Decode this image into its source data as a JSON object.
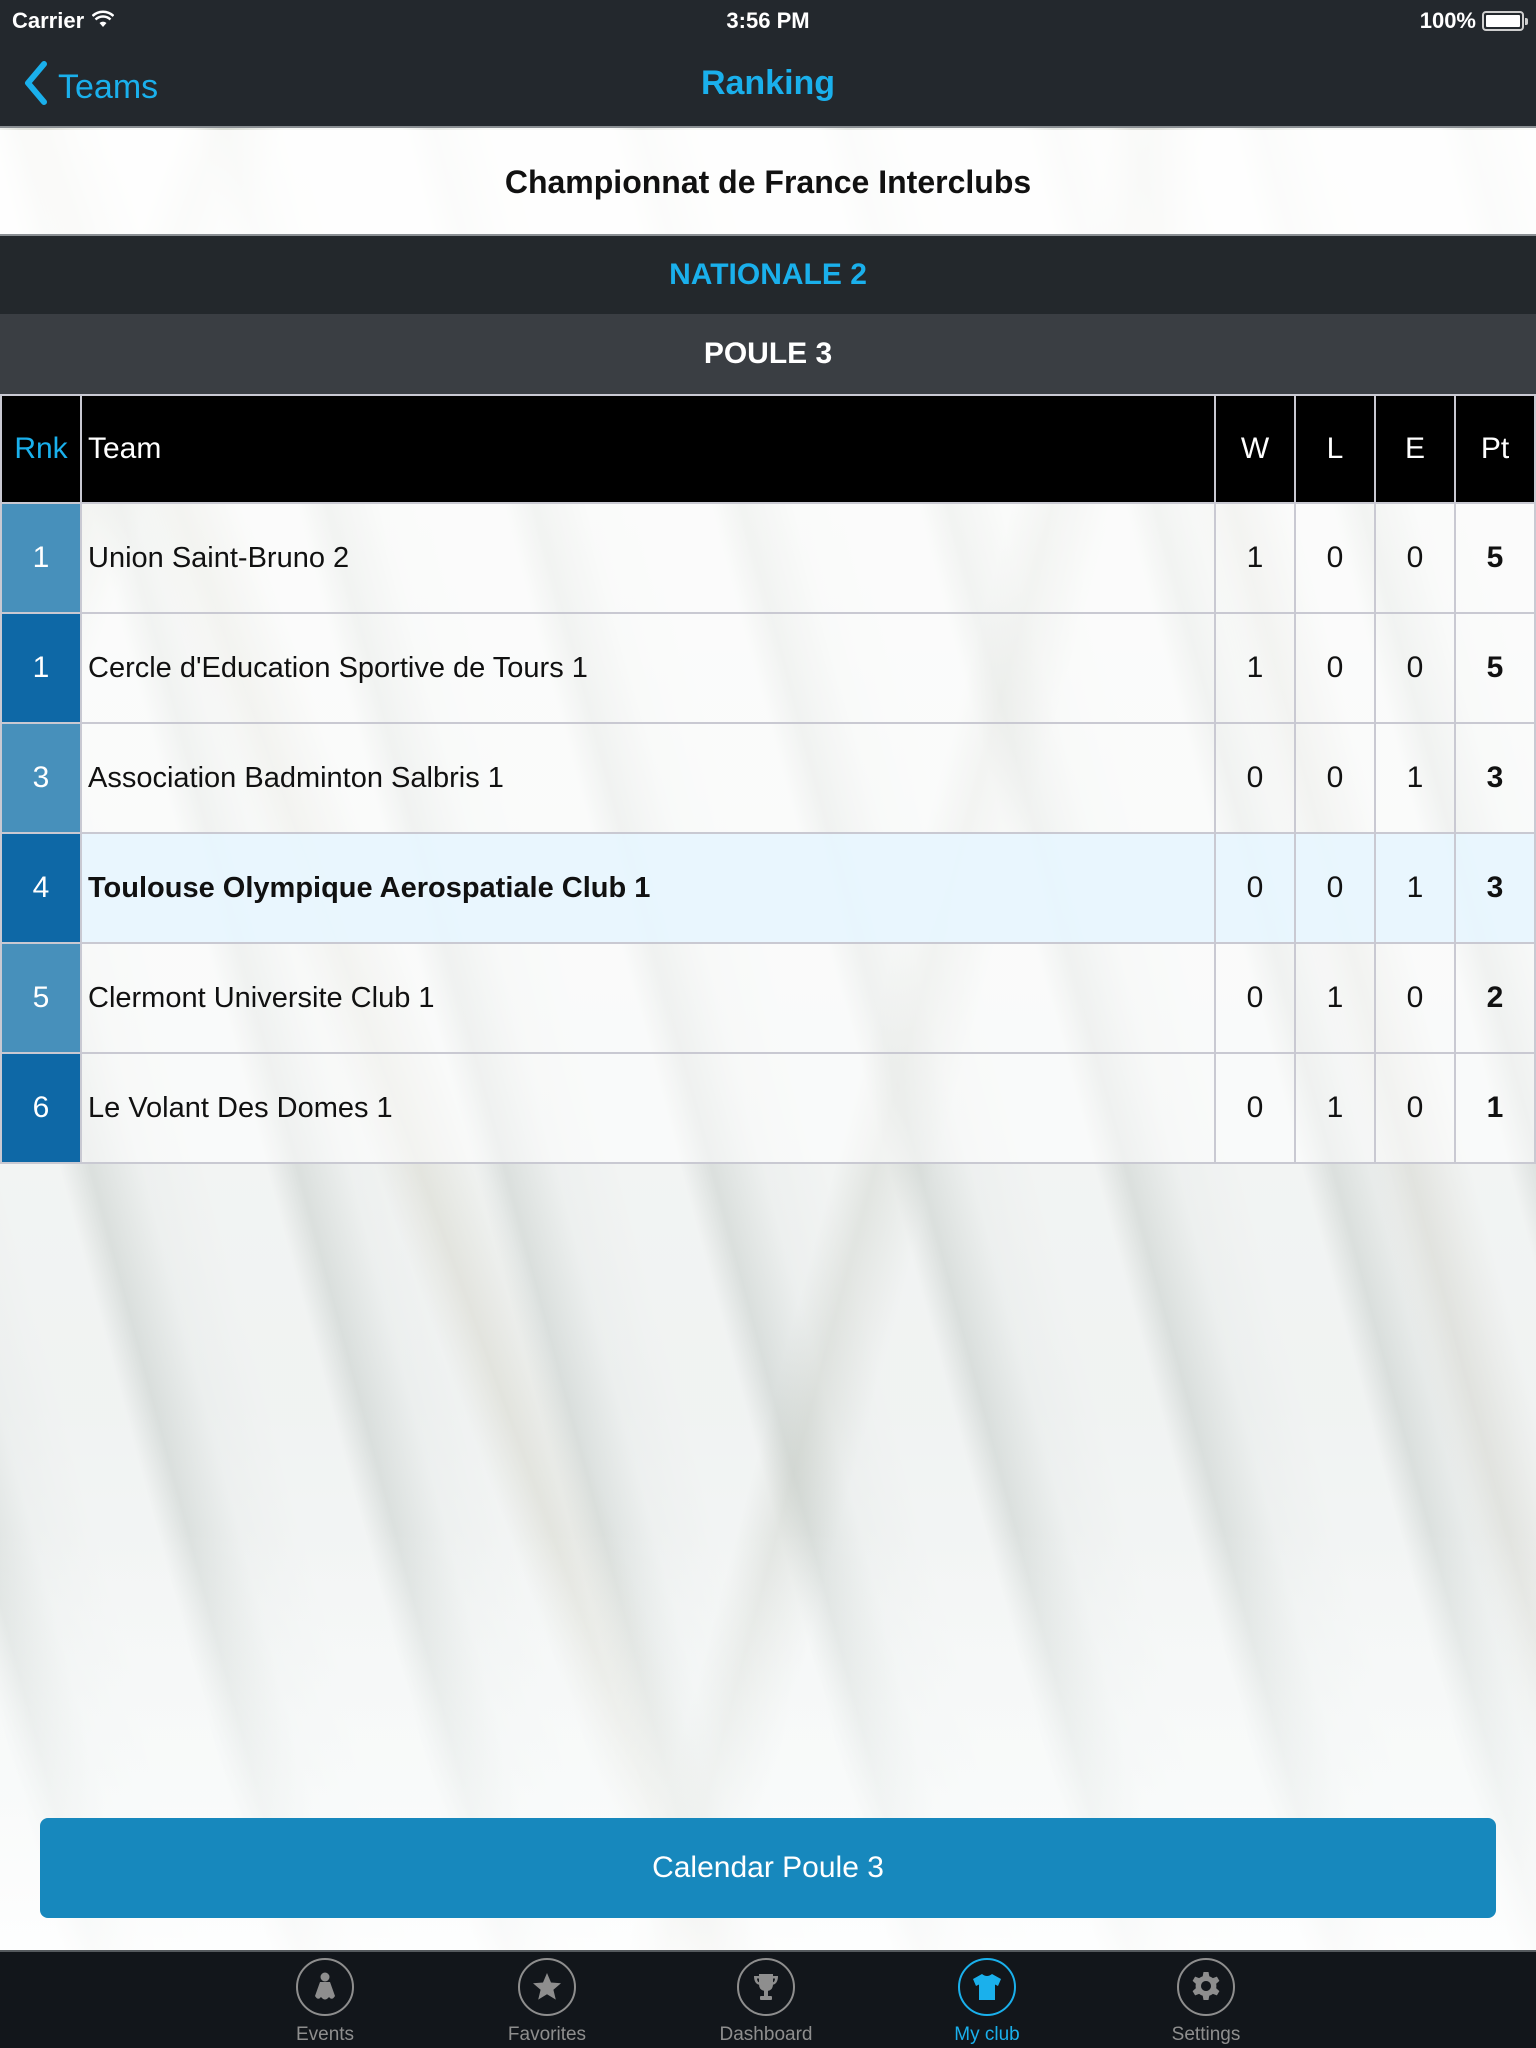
{
  "status_bar": {
    "carrier": "Carrier",
    "time": "3:56 PM",
    "battery": "100%"
  },
  "nav": {
    "back_label": "Teams",
    "title": "Ranking"
  },
  "competition": {
    "title": "Championnat de France Interclubs",
    "division": "NATIONALE 2",
    "poule": "POULE 3"
  },
  "table": {
    "headers": {
      "rank": "Rnk",
      "team": "Team",
      "won": "W",
      "lost": "L",
      "draw": "E",
      "points": "Pt"
    },
    "rows": [
      {
        "rank": "1",
        "team": "Union Saint-Bruno 2",
        "w": "1",
        "l": "0",
        "e": "0",
        "pt": "5"
      },
      {
        "rank": "1",
        "team": "Cercle d'Education Sportive de Tours 1",
        "w": "1",
        "l": "0",
        "e": "0",
        "pt": "5"
      },
      {
        "rank": "3",
        "team": "Association Badminton Salbris 1",
        "w": "0",
        "l": "0",
        "e": "1",
        "pt": "3"
      },
      {
        "rank": "4",
        "team": "Toulouse Olympique Aerospatiale Club 1",
        "w": "0",
        "l": "0",
        "e": "1",
        "pt": "3",
        "highlighted": true
      },
      {
        "rank": "5",
        "team": "Clermont Universite Club 1",
        "w": "0",
        "l": "1",
        "e": "0",
        "pt": "2"
      },
      {
        "rank": "6",
        "team": "Le Volant Des Domes 1",
        "w": "0",
        "l": "1",
        "e": "0",
        "pt": "1"
      }
    ]
  },
  "calendar_button": "Calendar Poule 3",
  "tab_bar": {
    "items": [
      {
        "label": "Events",
        "icon": "shuttlecock-icon"
      },
      {
        "label": "Favorites",
        "icon": "star-icon"
      },
      {
        "label": "Dashboard",
        "icon": "trophy-icon"
      },
      {
        "label": "My club",
        "icon": "jersey-icon",
        "active": true
      },
      {
        "label": "Settings",
        "icon": "gear-icon"
      }
    ]
  },
  "colors": {
    "accent": "#1ab0ec",
    "bar_dark": "#23282d",
    "rank_light": "#4790bb",
    "rank_dark": "#0e68a6",
    "button": "#1788bd",
    "highlight_row": "#e8f6fe"
  }
}
